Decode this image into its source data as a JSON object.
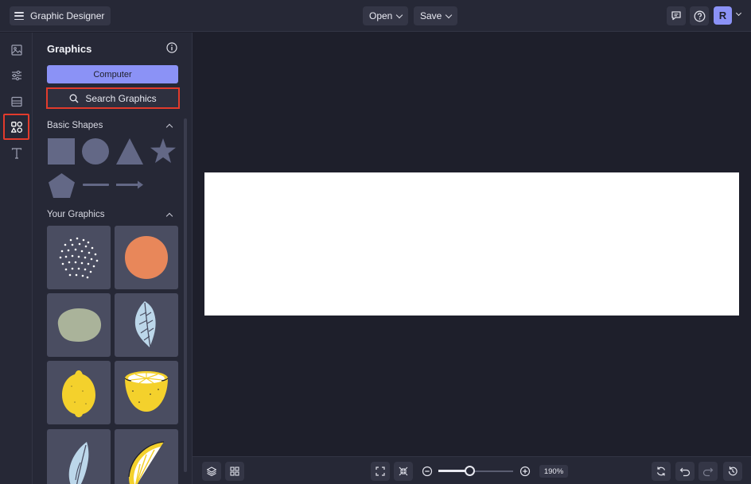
{
  "header": {
    "app_title": "Graphic Designer",
    "open_label": "Open",
    "save_label": "Save",
    "avatar_initial": "R",
    "icons": [
      "menu-icon",
      "comment-icon",
      "help-icon",
      "chevron-down-icon"
    ]
  },
  "rail": {
    "items": [
      {
        "name": "image-icon",
        "active": false
      },
      {
        "name": "adjustments-icon",
        "active": false
      },
      {
        "name": "layout-icon",
        "active": false
      },
      {
        "name": "graphics-icon",
        "active": true
      },
      {
        "name": "text-icon",
        "active": false
      }
    ]
  },
  "panel": {
    "title": "Graphics",
    "computer_label": "Computer",
    "search_label": "Search Graphics",
    "basic_shapes_heading": "Basic Shapes",
    "your_graphics_heading": "Your Graphics",
    "basic_shapes": [
      "square",
      "circle",
      "triangle",
      "star",
      "pentagon",
      "line",
      "arrow"
    ],
    "your_graphics": [
      "dots-graphic",
      "orange-circle-graphic",
      "green-blob-graphic",
      "leaf-graphic",
      "lemon-graphic",
      "lemon-half-graphic",
      "leaf-slice-graphic",
      "lemon-slice-graphic"
    ]
  },
  "bottombar": {
    "zoom_percent": "190%",
    "zoom_level": 0.42
  },
  "colors": {
    "accent": "#8b92f6",
    "highlight": "#e23b2c",
    "shape_fill": "#636886",
    "canvas": "#ffffff"
  }
}
